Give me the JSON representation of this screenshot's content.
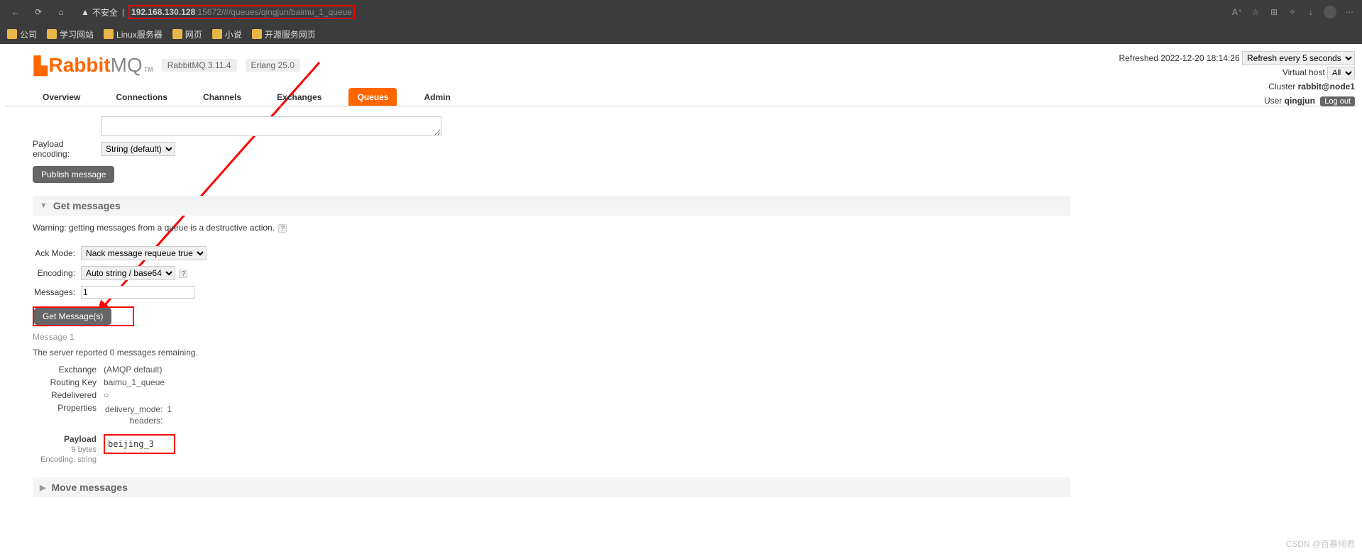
{
  "browser": {
    "insecure_label": "不安全",
    "url_highlight": "192.168.130.128",
    "url_rest": ":15672/#/queues/qingjun/baimu_1_queue",
    "bookmarks": [
      "公司",
      "学习网站",
      "Linux服务器",
      "网页",
      "小说",
      "开源服务网页"
    ]
  },
  "header": {
    "logo_text_a": "Rabbit",
    "logo_text_b": "MQ",
    "tm": "TM",
    "version": "RabbitMQ 3.11.4",
    "erlang": "Erlang 25.0"
  },
  "top_info": {
    "refreshed_label": "Refreshed 2022-12-20 18:14:26",
    "refresh_select": "Refresh every 5 seconds",
    "vhost_label": "Virtual host",
    "vhost_value": "All",
    "cluster_label": "Cluster",
    "cluster_value": "rabbit@node1",
    "user_label": "User",
    "user_value": "qingjun",
    "logout": "Log out"
  },
  "tabs": {
    "overview": "Overview",
    "connections": "Connections",
    "channels": "Channels",
    "exchanges": "Exchanges",
    "queues": "Queues",
    "admin": "Admin"
  },
  "publish": {
    "payload_encoding_label": "Payload encoding:",
    "payload_encoding_value": "String (default)",
    "publish_btn": "Publish message"
  },
  "get_messages": {
    "section_title": "Get messages",
    "warning": "Warning: getting messages from a queue is a destructive action.",
    "ack_mode_label": "Ack Mode:",
    "ack_mode_value": "Nack message requeue true",
    "encoding_label": "Encoding:",
    "encoding_value": "Auto string / base64",
    "messages_label": "Messages:",
    "messages_value": "1",
    "get_btn": "Get Message(s)"
  },
  "result": {
    "message_n": "Message 1",
    "remaining": "The server reported 0 messages remaining.",
    "exchange_label": "Exchange",
    "exchange_value": "(AMQP default)",
    "routing_key_label": "Routing Key",
    "routing_key_value": "baimu_1_queue",
    "redelivered_label": "Redelivered",
    "redelivered_value": "○",
    "properties_label": "Properties",
    "delivery_mode_label": "delivery_mode:",
    "delivery_mode_value": "1",
    "headers_label": "headers:",
    "payload_label": "Payload",
    "payload_bytes": "9 bytes",
    "payload_encoding": "Encoding: string",
    "payload_value": "beijing_3"
  },
  "move": {
    "section_title": "Move messages"
  },
  "watermark": "CSDN @百慕倾君"
}
